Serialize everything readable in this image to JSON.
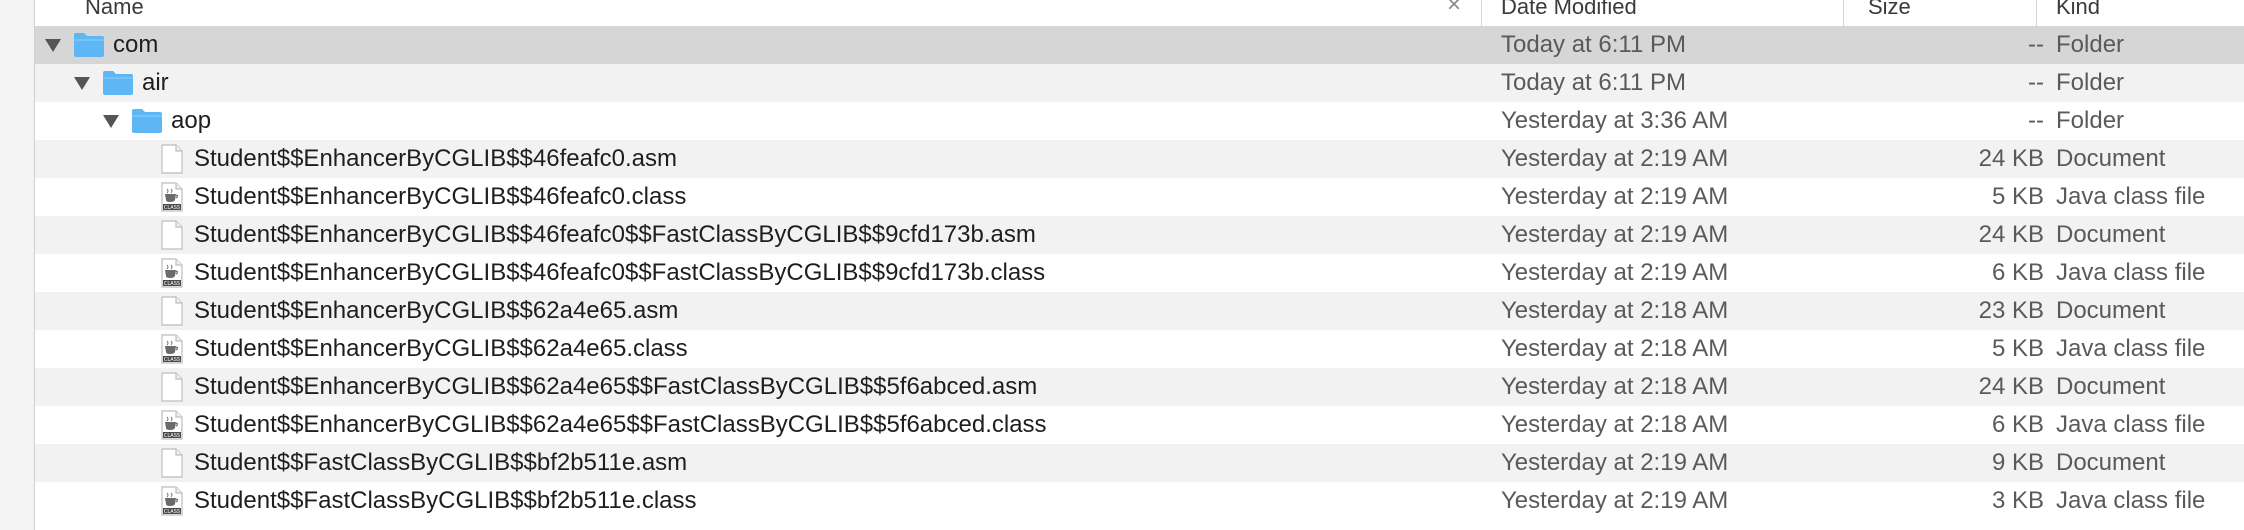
{
  "header": {
    "columns": [
      "Name",
      "Date Modified",
      "Size",
      "Kind"
    ]
  },
  "rows": [
    {
      "indent": 0,
      "expanded": true,
      "icon": "folder-icon",
      "name": "com",
      "date": "Today at 6:11 PM",
      "size": "--",
      "kind": "Folder"
    },
    {
      "indent": 1,
      "expanded": true,
      "icon": "folder-icon",
      "name": "air",
      "date": "Today at 6:11 PM",
      "size": "--",
      "kind": "Folder"
    },
    {
      "indent": 2,
      "expanded": true,
      "icon": "folder-icon",
      "name": "aop",
      "date": "Yesterday at 3:36 AM",
      "size": "--",
      "kind": "Folder"
    },
    {
      "indent": 3,
      "expanded": null,
      "icon": "document-icon",
      "name": "Student$$EnhancerByCGLIB$$46feafc0.asm",
      "date": "Yesterday at 2:19 AM",
      "size": "24 KB",
      "kind": "Document"
    },
    {
      "indent": 3,
      "expanded": null,
      "icon": "java-class-icon",
      "name": "Student$$EnhancerByCGLIB$$46feafc0.class",
      "date": "Yesterday at 2:19 AM",
      "size": "5 KB",
      "kind": "Java class file"
    },
    {
      "indent": 3,
      "expanded": null,
      "icon": "document-icon",
      "name": "Student$$EnhancerByCGLIB$$46feafc0$$FastClassByCGLIB$$9cfd173b.asm",
      "date": "Yesterday at 2:19 AM",
      "size": "24 KB",
      "kind": "Document"
    },
    {
      "indent": 3,
      "expanded": null,
      "icon": "java-class-icon",
      "name": "Student$$EnhancerByCGLIB$$46feafc0$$FastClassByCGLIB$$9cfd173b.class",
      "date": "Yesterday at 2:19 AM",
      "size": "6 KB",
      "kind": "Java class file"
    },
    {
      "indent": 3,
      "expanded": null,
      "icon": "document-icon",
      "name": "Student$$EnhancerByCGLIB$$62a4e65.asm",
      "date": "Yesterday at 2:18 AM",
      "size": "23 KB",
      "kind": "Document"
    },
    {
      "indent": 3,
      "expanded": null,
      "icon": "java-class-icon",
      "name": "Student$$EnhancerByCGLIB$$62a4e65.class",
      "date": "Yesterday at 2:18 AM",
      "size": "5 KB",
      "kind": "Java class file"
    },
    {
      "indent": 3,
      "expanded": null,
      "icon": "document-icon",
      "name": "Student$$EnhancerByCGLIB$$62a4e65$$FastClassByCGLIB$$5f6abced.asm",
      "date": "Yesterday at 2:18 AM",
      "size": "24 KB",
      "kind": "Document"
    },
    {
      "indent": 3,
      "expanded": null,
      "icon": "java-class-icon",
      "name": "Student$$EnhancerByCGLIB$$62a4e65$$FastClassByCGLIB$$5f6abced.class",
      "date": "Yesterday at 2:18 AM",
      "size": "6 KB",
      "kind": "Java class file"
    },
    {
      "indent": 3,
      "expanded": null,
      "icon": "document-icon",
      "name": "Student$$FastClassByCGLIB$$bf2b511e.asm",
      "date": "Yesterday at 2:19 AM",
      "size": "9 KB",
      "kind": "Document"
    },
    {
      "indent": 3,
      "expanded": null,
      "icon": "java-class-icon",
      "name": "Student$$FastClassByCGLIB$$bf2b511e.class",
      "date": "Yesterday at 2:19 AM",
      "size": "3 KB",
      "kind": "Java class file"
    }
  ],
  "selected_row": 0,
  "colors": {
    "folder": "#5eb7f4",
    "selection": "#d6d6d6",
    "stripe": "#f2f2f2"
  }
}
